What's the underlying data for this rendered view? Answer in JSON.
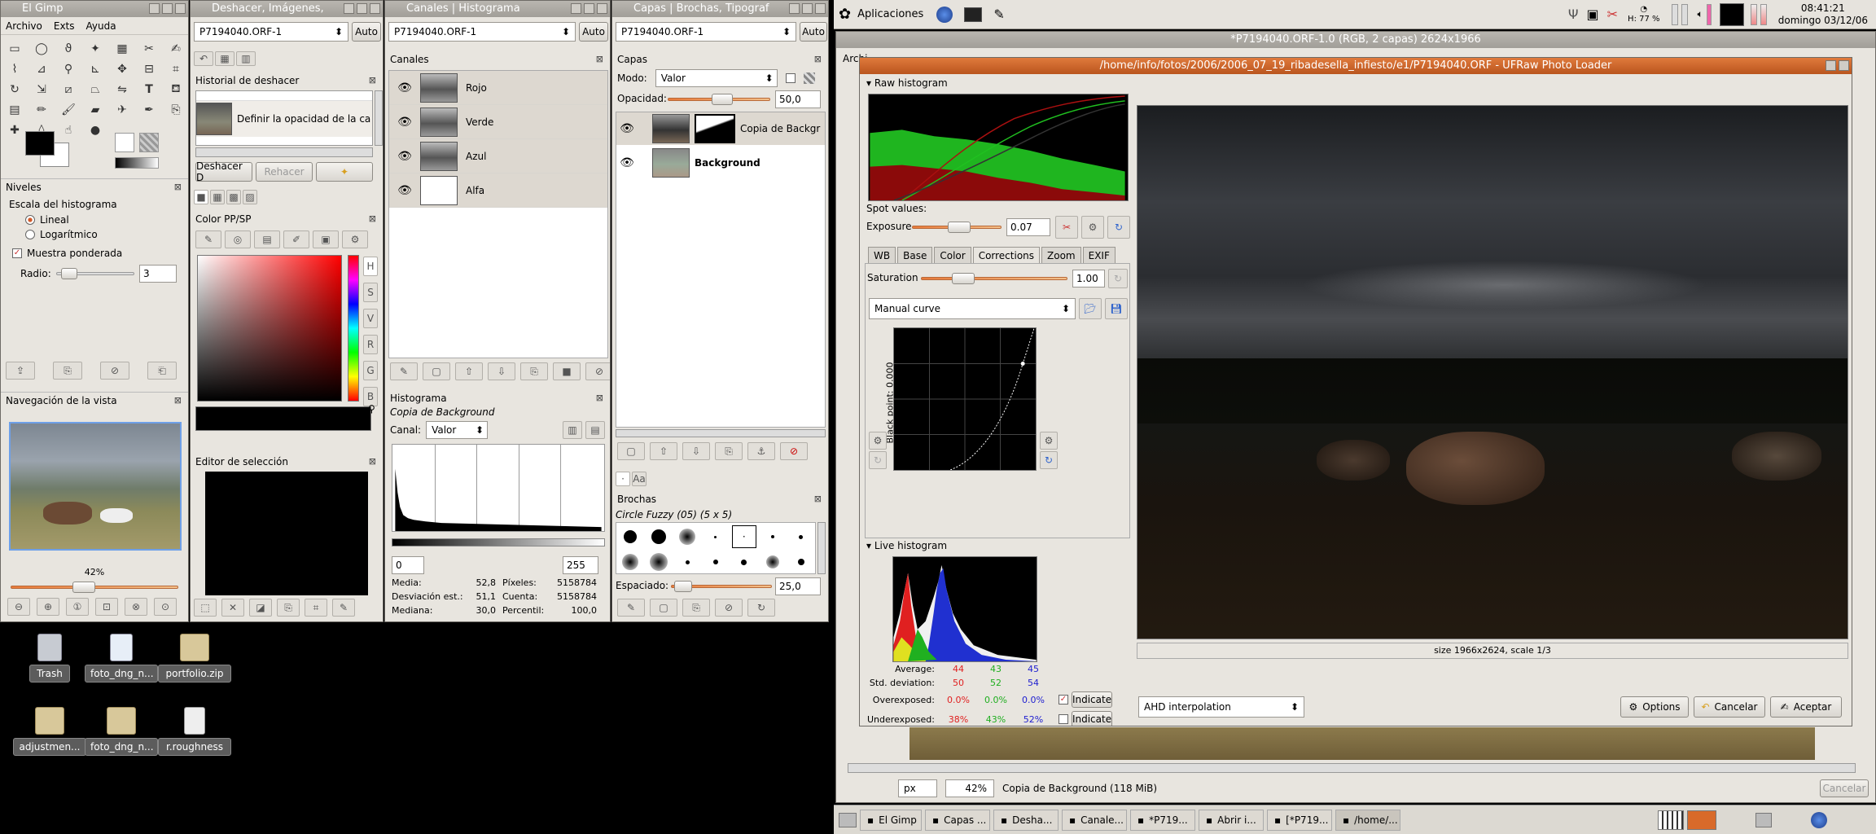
{
  "topbar": {
    "apps_label": "Aplicaciones",
    "battery": "H: 77 %",
    "time": "08:41:21",
    "date": "domingo 03/12/06"
  },
  "gimp_main": {
    "title": "El Gimp",
    "menus": [
      "Archivo",
      "Exts",
      "Ayuda"
    ],
    "levels": {
      "title": "Niveles",
      "scale_label": "Escala del histograma",
      "linear": "Lineal",
      "log": "Logarítmico",
      "weighted": "Muestra ponderada",
      "radius_label": "Radio:",
      "radius": "3"
    },
    "nav": {
      "title": "Navegación de la vista",
      "zoom": "42%"
    }
  },
  "undo_win": {
    "title": "Deshacer, Imágenes,",
    "image_combo": "P7194040.ORF-1",
    "auto": "Auto",
    "history_title": "Historial de deshacer",
    "history_item": "Definir la opacidad de la ca",
    "undo_btn": "Deshacer D",
    "redo_btn": "Rehacer",
    "color_title": "Color PP/SP",
    "color_channels": [
      "H",
      "S",
      "V",
      "R",
      "G",
      "B"
    ],
    "selection_title": "Editor de selección"
  },
  "channels_win": {
    "title": "Canales | Histograma",
    "image_combo": "P7194040.ORF-1",
    "auto": "Auto",
    "channels_title": "Canales",
    "channels": [
      "Rojo",
      "Verde",
      "Azul",
      "Alfa"
    ],
    "hist_title": "Histograma",
    "hist_layer": "Copia de Background",
    "canal_label": "Canal:",
    "canal_value": "Valor",
    "range_min": "0",
    "range_max": "255",
    "stats": {
      "media_l": "Media:",
      "media": "52,8",
      "pix_l": "Píxeles:",
      "pix": "5158784",
      "dev_l": "Desviación est.:",
      "dev": "51,1",
      "count_l": "Cuenta:",
      "count": "5158784",
      "med_l": "Mediana:",
      "med": "30,0",
      "perc_l": "Percentil:",
      "perc": "100,0"
    }
  },
  "layers_win": {
    "title": "Capas | Brochas, Tipograf",
    "image_combo": "P7194040.ORF-1",
    "auto": "Auto",
    "layers_title": "Capas",
    "mode_label": "Modo:",
    "mode_value": "Valor",
    "opacity_label": "Opacidad:",
    "opacity": "50,0",
    "layers": [
      "Copia de Backgr",
      "Background"
    ],
    "brushes_title": "Brochas",
    "brush_name": "Circle Fuzzy (05) (5 x 5)",
    "spacing_label": "Espaciado:",
    "spacing": "25,0"
  },
  "image_win": {
    "title": "*P7194040.ORF-1.0 (RGB, 2 capas) 2624x1966",
    "menu_first": "Archi",
    "unit": "px",
    "zoom": "42%",
    "status": "Copia de Background (118 MiB)",
    "cancel": "Cancelar"
  },
  "ufraw": {
    "title": "/home/info/fotos/2006/2006_07_19_ribadesella_infiesto/e1/P7194040.ORF - UFRaw Photo Loader",
    "raw_hist": "Raw histogram",
    "spot": "Spot values:",
    "exposure_label": "Exposure",
    "exposure": "0.07",
    "tabs": [
      "WB",
      "Base",
      "Color",
      "Corrections",
      "Zoom",
      "EXIF"
    ],
    "active_tab": "Corrections",
    "saturation_label": "Saturation",
    "saturation": "1.00",
    "curve": "Manual curve",
    "black_point": "Black point: 0.000",
    "live_hist": "Live histogram",
    "stats": {
      "avg_l": "Average:",
      "avg": [
        "44",
        "43",
        "45"
      ],
      "std_l": "Std. deviation:",
      "std": [
        "50",
        "52",
        "54"
      ],
      "over_l": "Overexposed:",
      "over": [
        "0.0%",
        "0.0%",
        "0.0%"
      ],
      "under_l": "Underexposed:",
      "under": [
        "38%",
        "43%",
        "52%"
      ],
      "indicate": "Indicate"
    },
    "size_info": "size 1966x2624, scale 1/3",
    "interp": "AHD interpolation",
    "options": "Options",
    "cancel": "Cancelar",
    "accept": "Aceptar",
    "colors": {
      "red": "#e02020",
      "green": "#1fae1f",
      "blue": "#2020d0"
    }
  },
  "desktop": [
    "Trash",
    "foto_dng_n...",
    "portfolio.zip",
    "adjustmen...",
    "foto_dng_n...",
    "r.roughness"
  ],
  "taskbar": [
    "El Gimp",
    "Capas ...",
    "Desha...",
    "Canale...",
    "*P719...",
    "Abrir i...",
    "[*P719...",
    "/home/..."
  ]
}
